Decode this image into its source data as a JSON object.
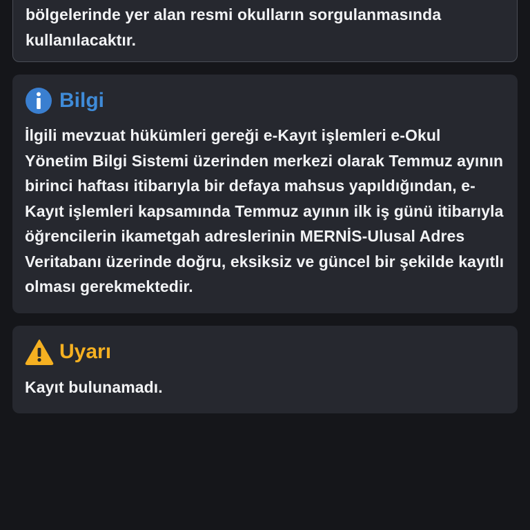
{
  "top_card": {
    "text": "bölgelerinde yer alan resmi okulların sorgulanmasında kullanılacaktır."
  },
  "info_card": {
    "icon": "info-icon",
    "title": "Bilgi",
    "title_color": "#3f8bd8",
    "text": "İlgili mevzuat hükümleri gereği e-Kayıt işlemleri e-Okul Yönetim Bilgi Sistemi üzerinden merkezi olarak Temmuz ayının birinci haftası itibarıyla bir defaya mahsus yapıldığından, e-Kayıt işlemleri kapsamında Temmuz ayının ilk iş günü itibarıyla öğrencilerin ikametgah adreslerinin MERNİS-Ulusal Adres Veritabanı üzerinde doğru, eksiksiz ve güncel bir şekilde kayıtlı olması gerekmektedir."
  },
  "warning_card": {
    "icon": "warning-icon",
    "title": "Uyarı",
    "title_color": "#f5b021",
    "text": "Kayıt bulunamadı."
  }
}
